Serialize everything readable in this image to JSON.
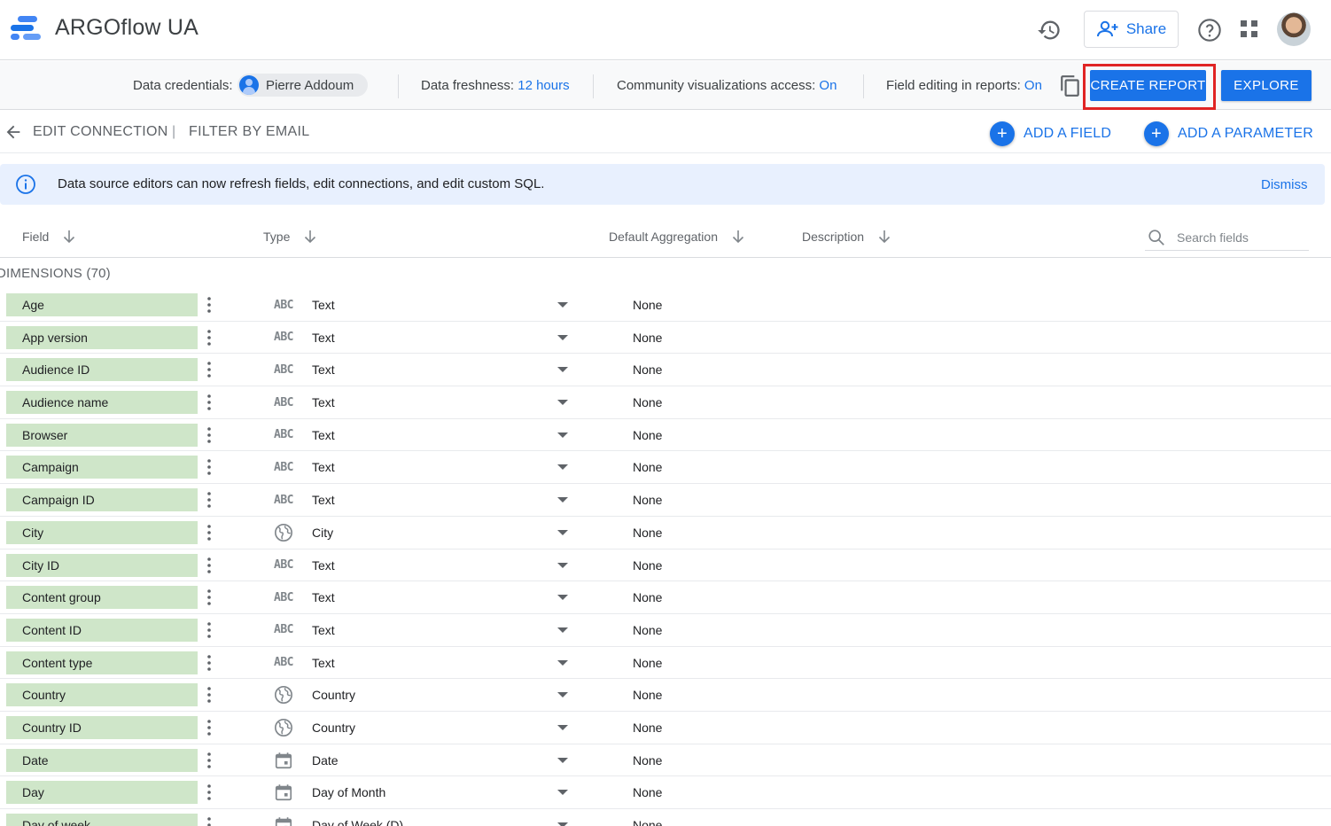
{
  "header": {
    "app_title": "ARGOflow UA",
    "share_label": "Share",
    "logo_colors": [
      "#4285f4",
      "#1a73e8",
      "#669df6"
    ]
  },
  "infobar": {
    "credentials_label": "Data credentials:",
    "credentials_user": "Pierre Addoum",
    "freshness_label": "Data freshness:",
    "freshness_value": "12 hours",
    "community_label": "Community visualizations access:",
    "community_value": "On",
    "field_editing_label": "Field editing in reports:",
    "field_editing_value": "On",
    "create_report_label": "CREATE REPORT",
    "explore_label": "EXPLORE"
  },
  "actionbar": {
    "edit_connection": "EDIT CONNECTION",
    "separator": "|",
    "filter_by_email": "FILTER BY EMAIL",
    "add_field": "ADD A FIELD",
    "add_parameter": "ADD A PARAMETER"
  },
  "banner": {
    "text": "Data source editors can now refresh fields, edit connections, and edit custom SQL.",
    "dismiss": "Dismiss"
  },
  "table": {
    "columns": {
      "field": "Field",
      "type": "Type",
      "aggregation": "Default Aggregation",
      "description": "Description"
    },
    "search_placeholder": "Search fields",
    "section_label": "DIMENSIONS (70)",
    "rows": [
      {
        "field": "Age",
        "type_icon": "ABC",
        "type": "Text",
        "aggregation": "None"
      },
      {
        "field": "App version",
        "type_icon": "ABC",
        "type": "Text",
        "aggregation": "None"
      },
      {
        "field": "Audience ID",
        "type_icon": "ABC",
        "type": "Text",
        "aggregation": "None"
      },
      {
        "field": "Audience name",
        "type_icon": "ABC",
        "type": "Text",
        "aggregation": "None"
      },
      {
        "field": "Browser",
        "type_icon": "ABC",
        "type": "Text",
        "aggregation": "None"
      },
      {
        "field": "Campaign",
        "type_icon": "ABC",
        "type": "Text",
        "aggregation": "None"
      },
      {
        "field": "Campaign ID",
        "type_icon": "ABC",
        "type": "Text",
        "aggregation": "None"
      },
      {
        "field": "City",
        "type_icon": "globe",
        "type": "City",
        "aggregation": "None"
      },
      {
        "field": "City ID",
        "type_icon": "ABC",
        "type": "Text",
        "aggregation": "None"
      },
      {
        "field": "Content group",
        "type_icon": "ABC",
        "type": "Text",
        "aggregation": "None"
      },
      {
        "field": "Content ID",
        "type_icon": "ABC",
        "type": "Text",
        "aggregation": "None"
      },
      {
        "field": "Content type",
        "type_icon": "ABC",
        "type": "Text",
        "aggregation": "None"
      },
      {
        "field": "Country",
        "type_icon": "globe",
        "type": "Country",
        "aggregation": "None"
      },
      {
        "field": "Country ID",
        "type_icon": "globe",
        "type": "Country",
        "aggregation": "None"
      },
      {
        "field": "Date",
        "type_icon": "calendar",
        "type": "Date",
        "aggregation": "None"
      },
      {
        "field": "Day",
        "type_icon": "calendar",
        "type": "Day of Month",
        "aggregation": "None"
      },
      {
        "field": "Day of week",
        "type_icon": "calendar",
        "type": "Day of Week (D)",
        "aggregation": "None"
      }
    ]
  }
}
